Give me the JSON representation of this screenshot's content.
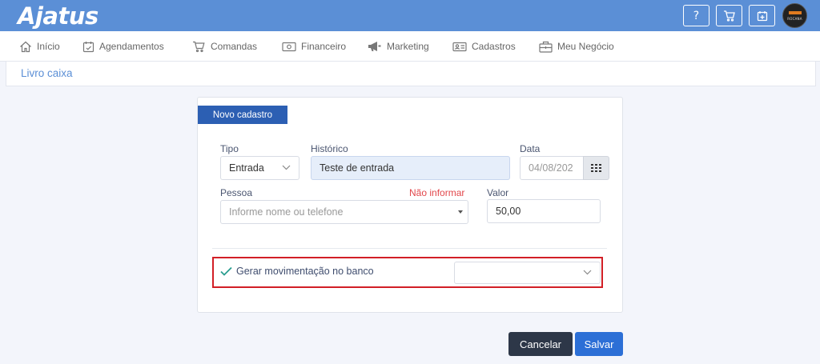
{
  "app": {
    "logo_text": "Ajatus",
    "brand_color": "#5b8fd6",
    "avatar_text": "ROCANA"
  },
  "topbar": {
    "buttons": [
      {
        "icon": "help-icon",
        "label": "?"
      },
      {
        "icon": "cart-icon"
      },
      {
        "icon": "calendar-add-icon"
      }
    ]
  },
  "nav": {
    "items": [
      {
        "label": "Início",
        "icon": "home-icon"
      },
      {
        "label": "Agendamentos",
        "icon": "calendar-icon"
      },
      {
        "label": "Comandas",
        "icon": "cart-icon"
      },
      {
        "label": "Financeiro",
        "icon": "money-icon"
      },
      {
        "label": "Marketing",
        "icon": "megaphone-icon"
      },
      {
        "label": "Cadastros",
        "icon": "id-card-icon"
      },
      {
        "label": "Meu Negócio",
        "icon": "briefcase-icon"
      }
    ]
  },
  "page": {
    "title": "Livro caixa"
  },
  "form": {
    "tab_label": "Novo cadastro",
    "tipo": {
      "label": "Tipo",
      "value": "Entrada"
    },
    "historico": {
      "label": "Histórico",
      "value": "Teste de entrada"
    },
    "data": {
      "label": "Data",
      "value": "04/08/202"
    },
    "pessoa": {
      "label": "Pessoa",
      "placeholder": "Informe nome ou telefone",
      "link": "Não informar"
    },
    "valor": {
      "label": "Valor",
      "value": "50,00"
    },
    "bank": {
      "checkbox_label": "Gerar movimentação no banco",
      "checked": true,
      "selected": ""
    }
  },
  "actions": {
    "cancel": "Cancelar",
    "save": "Salvar"
  },
  "colors": {
    "highlight": "#d21f26",
    "check": "#2a9d8f",
    "cancel_bg": "#2d3748",
    "save_bg": "#2c6fd6"
  }
}
